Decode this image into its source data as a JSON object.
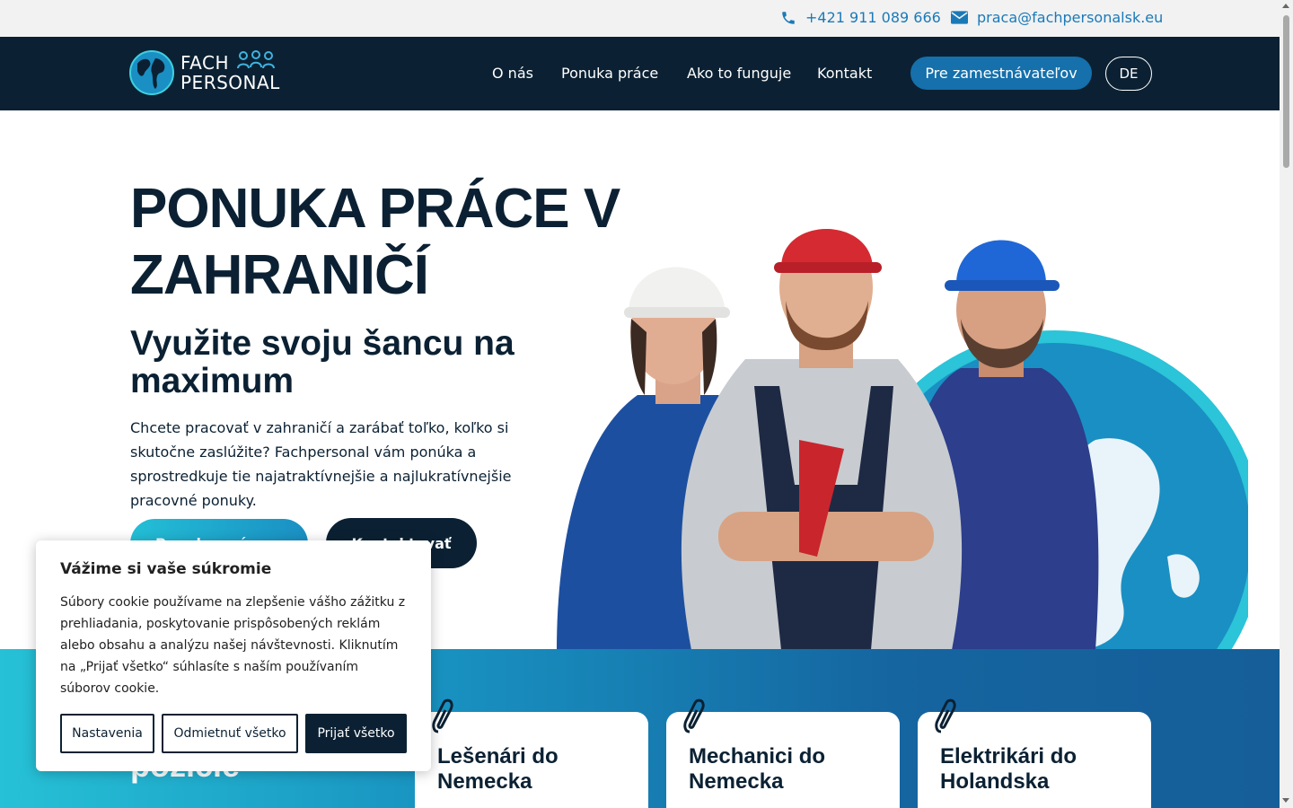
{
  "topbar": {
    "phone": "+421 911 089 666",
    "email": "praca@fachpersonalsk.eu",
    "phone_icon": "phone-icon",
    "email_icon": "envelope-icon"
  },
  "nav": {
    "logo_line1": "FACH",
    "logo_line2": "PERSONAL",
    "links": [
      "O nás",
      "Ponuka práce",
      "Ako to funguje",
      "Kontakt"
    ],
    "cta": "Pre zamestnávateľov",
    "lang": "DE"
  },
  "hero": {
    "title": "PONUKA PRÁCE V ZAHRANIČÍ",
    "subtitle": "Využite svoju šancu na maximum",
    "text": "Chcete pracovať v zahraničí a zarábať toľko, koľko si skutočne zaslúžite? Fachpersonal vám ponúka a sprostredkuje tie najatraktívnejšie a najlukratívnejšie pracovné ponuky.",
    "btn_primary": "Ponuka práce →",
    "btn_secondary": "Kontaktovať"
  },
  "band": {
    "title": "pozície",
    "cards": [
      {
        "title": "Lešenári do Nemecka"
      },
      {
        "title": "Mechanici do Nemecka"
      },
      {
        "title": "Elektrikári do Holandska"
      }
    ]
  },
  "cookie": {
    "title": "Vážime si vaše súkromie",
    "text": "Súbory cookie používame na zlepšenie vášho zážitku z prehliadania, poskytovanie prispôsobených reklám alebo obsahu a analýzu našej návštevnosti. Kliknutím na „Prijať všetko“ súhlasíte s naším používaním súborov cookie.",
    "btn_settings": "Nastavenia",
    "btn_reject": "Odmietnuť všetko",
    "btn_accept": "Prijať všetko"
  },
  "colors": {
    "navy": "#0b2133",
    "accent_blue": "#1570ab",
    "cyan": "#26c1d6"
  }
}
